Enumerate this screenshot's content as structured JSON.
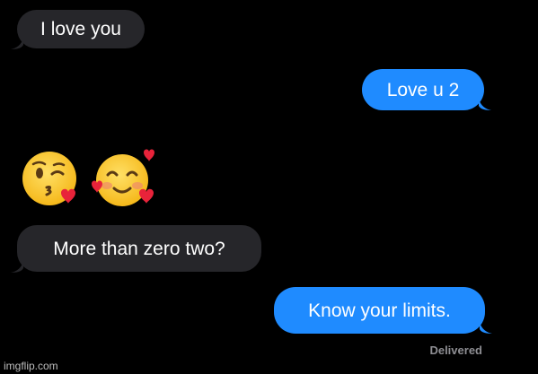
{
  "conversation": {
    "messages": [
      {
        "sender": "them",
        "text": "I love you"
      },
      {
        "sender": "me",
        "text": "Love u 2"
      },
      {
        "sender": "them",
        "emojis": [
          "face-blowing-a-kiss",
          "smiling-face-with-hearts"
        ]
      },
      {
        "sender": "them",
        "text": "More than zero two?"
      },
      {
        "sender": "me",
        "text": "Know your limits."
      }
    ],
    "status": "Delivered"
  },
  "watermark": "imgflip.com",
  "colors": {
    "background": "#000000",
    "incoming_bubble": "#26262a",
    "outgoing_bubble": "#1f8bff",
    "status_text": "#8e8e93"
  }
}
